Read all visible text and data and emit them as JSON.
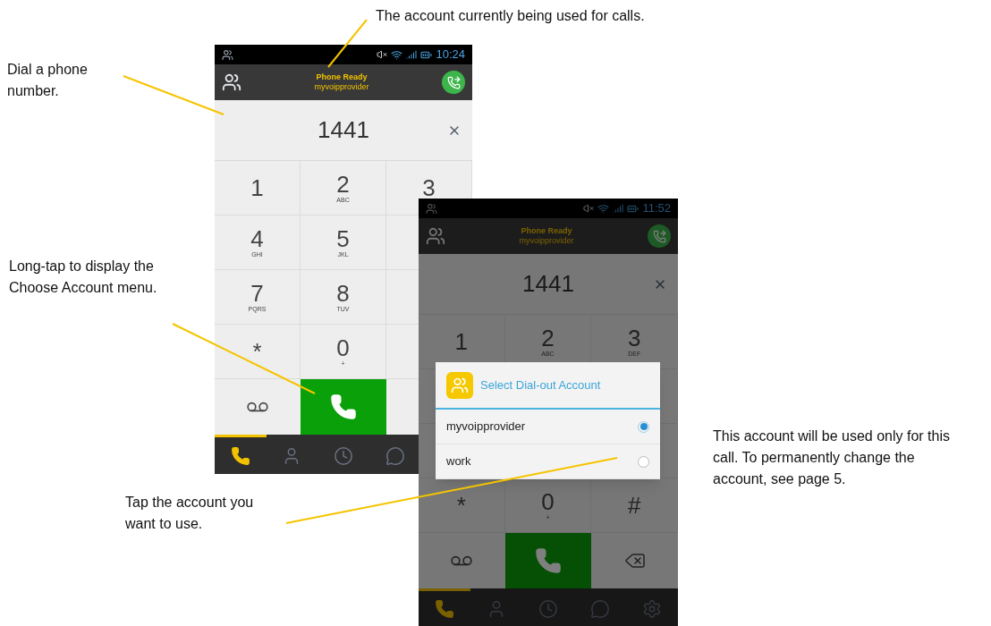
{
  "callouts": [
    {
      "text": "The account currently being used for calls."
    },
    {
      "text": "Dial a phone number."
    },
    {
      "text": "Long-tap to display the Choose Account menu."
    },
    {
      "text": "Tap the account you want to use."
    },
    {
      "text": "This account will be used only for this call. To permanently change the account, see page 5."
    }
  ],
  "phones": [
    {
      "status_bar": {
        "time": "10:24"
      },
      "header": {
        "title": "Phone Ready",
        "subtitle": "myvoipprovider"
      },
      "number_field": {
        "value": "1441"
      },
      "keypad_rows": [
        [
          {
            "digit": "1"
          },
          {
            "digit": "2",
            "letters": "ABC"
          },
          {
            "digit": "3"
          }
        ],
        [
          {
            "digit": "4",
            "letters": "GHI"
          },
          {
            "digit": "5",
            "letters": "JKL"
          }
        ],
        [
          {
            "digit": "7",
            "letters": "PQRS"
          },
          {
            "digit": "8",
            "letters": "TUV"
          }
        ],
        [
          {
            "digit": "*"
          },
          {
            "digit": "0",
            "letters": "+"
          }
        ]
      ],
      "bottom_row": [
        {
          "kind": "voicemail"
        },
        {
          "kind": "call"
        }
      ],
      "tabs": [
        {
          "kind": "phone",
          "selected": true
        },
        {
          "kind": "contacts",
          "selected": false
        },
        {
          "kind": "history",
          "selected": false
        },
        {
          "kind": "chat",
          "selected": false
        }
      ]
    },
    {
      "status_bar": {
        "time": "11:52"
      },
      "header": {
        "title": "Phone Ready",
        "subtitle": "myvoipprovider"
      },
      "number_field": {
        "value": "1441"
      },
      "keypad_rows": [
        [
          {
            "digit": "1"
          },
          {
            "digit": "2",
            "letters": "ABC"
          },
          {
            "digit": "3",
            "letters": "DEF"
          }
        ],
        [],
        [],
        [
          {
            "digit": "*"
          },
          {
            "digit": "0",
            "letters": "+"
          },
          {
            "digit": "#"
          }
        ]
      ],
      "bottom_row": [
        {
          "kind": "voicemail"
        },
        {
          "kind": "call"
        },
        {
          "kind": "backspace"
        }
      ],
      "tabs": [
        {
          "kind": "phone",
          "selected": true
        },
        {
          "kind": "contacts",
          "selected": false
        },
        {
          "kind": "history",
          "selected": false
        },
        {
          "kind": "chat",
          "selected": false
        },
        {
          "kind": "settings",
          "selected": false
        }
      ],
      "dialog": {
        "title": "Select Dial-out Account",
        "options": [
          {
            "label": "myvoipprovider",
            "selected": true
          },
          {
            "label": "work",
            "selected": false
          }
        ]
      }
    }
  ]
}
